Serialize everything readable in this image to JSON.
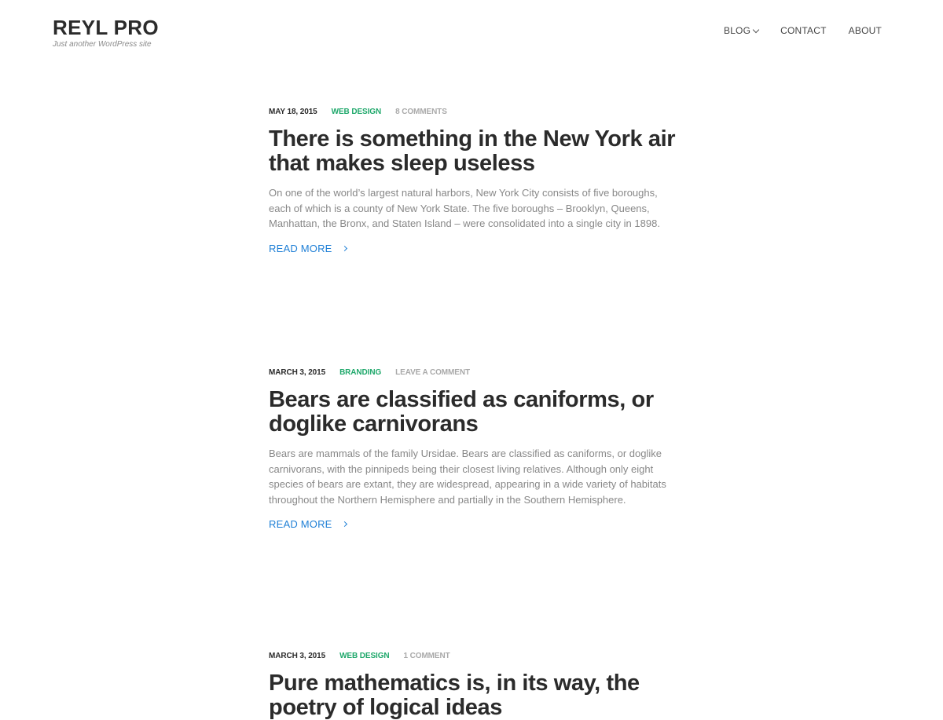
{
  "site": {
    "title": "REYL PRO",
    "description": "Just another WordPress site"
  },
  "nav": {
    "items": [
      {
        "label": "BLOG",
        "has_dropdown": true,
        "icon": "chevron-down-icon"
      },
      {
        "label": "CONTACT",
        "has_dropdown": false
      },
      {
        "label": "ABOUT",
        "has_dropdown": false
      }
    ]
  },
  "colors": {
    "category": "#1fa86b",
    "link": "#1e7fd6",
    "comments": "#a9a9a9",
    "text": "#2b2b2b",
    "excerpt": "#888888"
  },
  "posts": [
    {
      "date": "MAY 18, 2015",
      "category": "WEB DESIGN",
      "comments": "8 COMMENTS",
      "title": "There is something in the New York air that makes sleep useless",
      "excerpt": "On one of the world’s largest natural harbors, New York City consists of five boroughs, each of which is a county of New York State. The five boroughs – Brooklyn, Queens, Manhattan, the Bronx, and Staten Island – were consolidated into a single city in 1898.",
      "read_more": "READ MORE"
    },
    {
      "date": "MARCH 3, 2015",
      "category": "BRANDING",
      "comments": "LEAVE A COMMENT",
      "title": "Bears are classified as caniforms, or doglike carnivorans",
      "excerpt": "Bears are mammals of the family Ursidae. Bears are classified as caniforms, or doglike carnivorans, with the pinnipeds being their closest living relatives. Although only eight species of bears are extant, they are widespread, appearing in a wide variety of habitats throughout the Northern Hemisphere and partially in the Southern Hemisphere.",
      "read_more": "READ MORE"
    },
    {
      "date": "MARCH 3, 2015",
      "category": "WEB DESIGN",
      "comments": "1 COMMENT",
      "title": "Pure mathematics is, in its way, the poetry of logical ideas"
    }
  ]
}
